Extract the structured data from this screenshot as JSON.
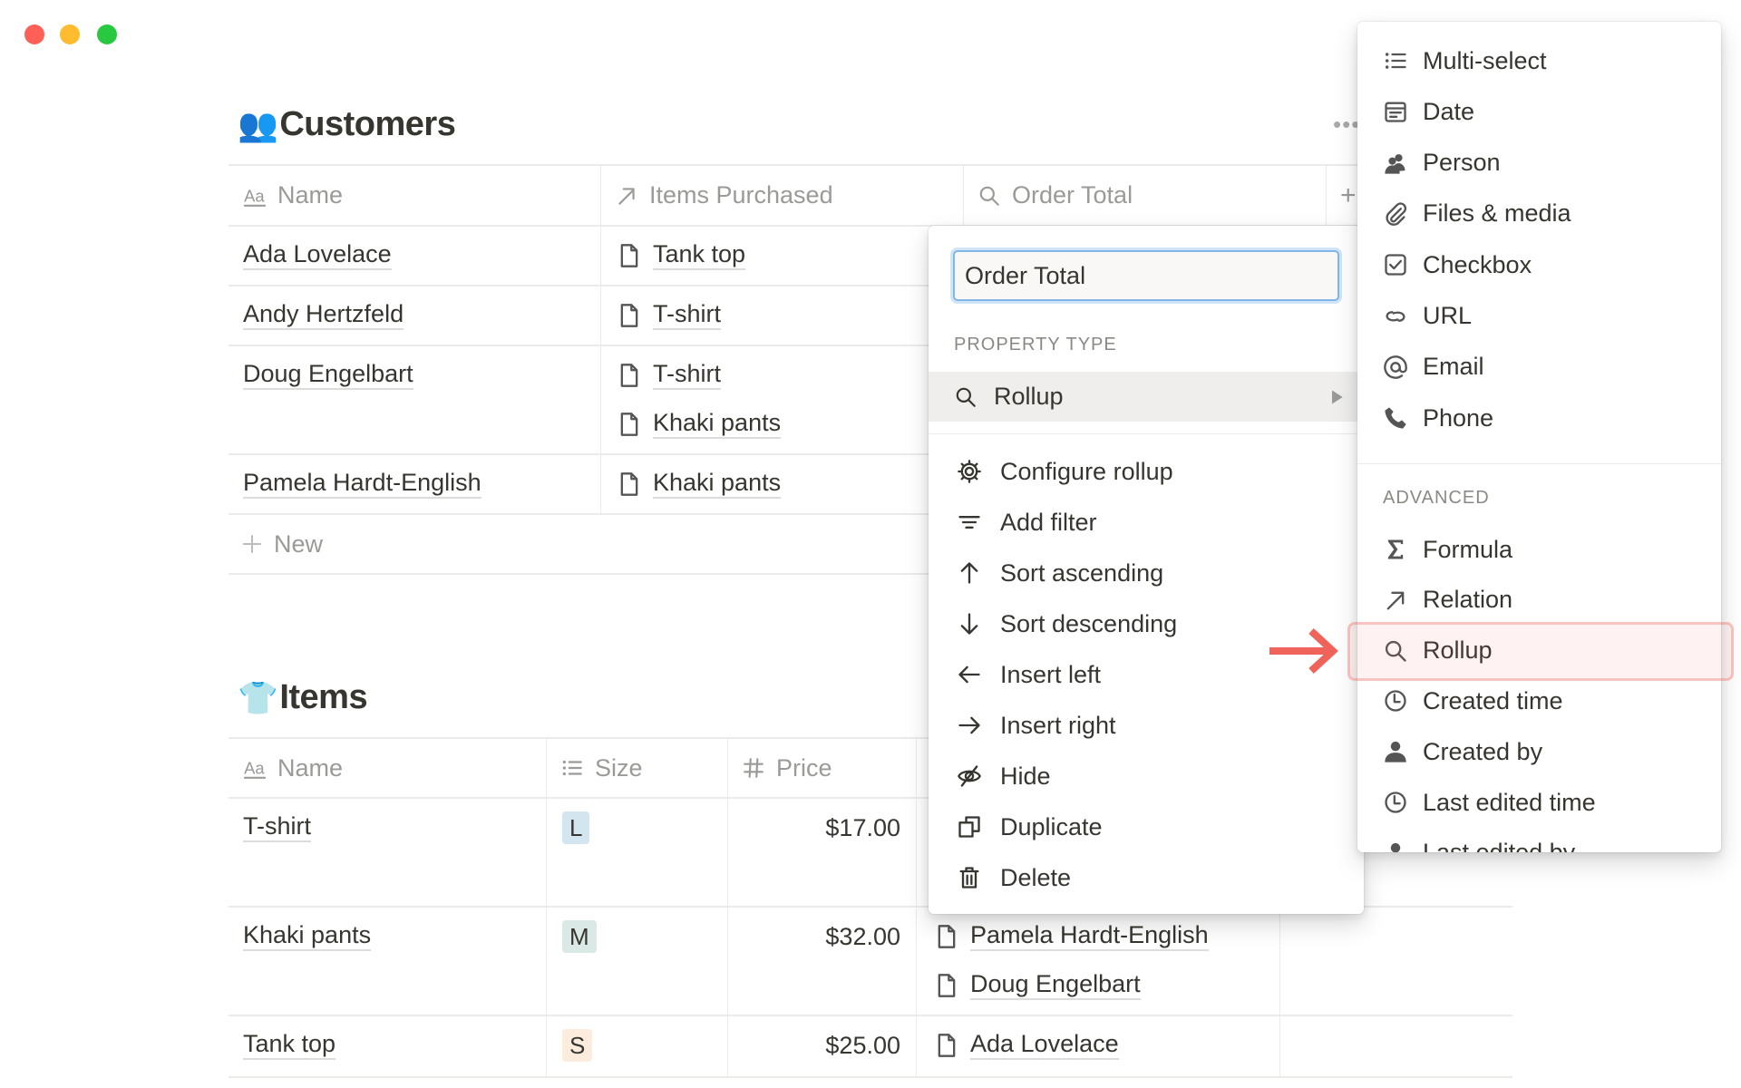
{
  "window": {
    "controls": [
      {
        "name": "close",
        "color": "#ff5f57"
      },
      {
        "name": "minimize",
        "color": "#febc2e"
      },
      {
        "name": "zoom",
        "color": "#28c840"
      }
    ]
  },
  "customers": {
    "emoji": "👥",
    "title": "Customers",
    "columns": [
      {
        "icon": "text-icon",
        "label": "Name"
      },
      {
        "icon": "arrow-up-right-icon",
        "label": "Items Purchased"
      },
      {
        "icon": "search-icon",
        "label": "Order Total"
      }
    ],
    "add_column": "+",
    "rows": [
      {
        "name": "Ada Lovelace",
        "items": [
          "Tank top"
        ]
      },
      {
        "name": "Andy Hertzfeld",
        "items": [
          "T-shirt"
        ]
      },
      {
        "name": "Doug Engelbart",
        "items": [
          "T-shirt",
          "Khaki pants"
        ]
      },
      {
        "name": "Pamela Hardt-English",
        "items": [
          "Khaki pants"
        ]
      }
    ],
    "new_label": "New"
  },
  "items": {
    "emoji": "👕",
    "title": "Items",
    "columns": [
      {
        "icon": "text-icon",
        "label": "Name"
      },
      {
        "icon": "list-icon",
        "label": "Size"
      },
      {
        "icon": "hash-icon",
        "label": "Price"
      }
    ],
    "rows": [
      {
        "name": "T-shirt",
        "size": "L",
        "size_color": "#d3e5ef",
        "price": "$17.00",
        "customers": []
      },
      {
        "name": "Khaki pants",
        "size": "M",
        "size_color": "#dbe9e6",
        "price": "$32.00",
        "customers": [
          "Pamela Hardt-English",
          "Doug Engelbart"
        ]
      },
      {
        "name": "Tank top",
        "size": "S",
        "size_color": "#fbecdd",
        "price": "$25.00",
        "customers": [
          "Ada Lovelace"
        ]
      }
    ]
  },
  "property_menu": {
    "name_input": "Order Total",
    "section_label": "PROPERTY TYPE",
    "type": {
      "icon": "search-icon",
      "label": "Rollup"
    },
    "actions": [
      {
        "icon": "gear-icon",
        "label": "Configure rollup"
      },
      {
        "icon": "filter-icon",
        "label": "Add filter"
      },
      {
        "icon": "arrow-up-icon",
        "label": "Sort ascending"
      },
      {
        "icon": "arrow-down-icon",
        "label": "Sort descending"
      },
      {
        "icon": "arrow-left-icon",
        "label": "Insert left"
      },
      {
        "icon": "arrow-right-icon",
        "label": "Insert right"
      },
      {
        "icon": "eye-off-icon",
        "label": "Hide"
      },
      {
        "icon": "duplicate-icon",
        "label": "Duplicate"
      },
      {
        "icon": "trash-icon",
        "label": "Delete"
      }
    ]
  },
  "type_menu": {
    "basic": [
      {
        "icon": "list-icon",
        "label": "Multi-select"
      },
      {
        "icon": "calendar-icon",
        "label": "Date"
      },
      {
        "icon": "people-icon",
        "label": "Person"
      },
      {
        "icon": "paperclip-icon",
        "label": "Files & media"
      },
      {
        "icon": "checkbox-icon",
        "label": "Checkbox"
      },
      {
        "icon": "link-icon",
        "label": "URL"
      },
      {
        "icon": "at-icon",
        "label": "Email"
      },
      {
        "icon": "phone-icon",
        "label": "Phone"
      }
    ],
    "advanced_label": "ADVANCED",
    "advanced": [
      {
        "icon": "sigma-icon",
        "label": "Formula"
      },
      {
        "icon": "arrow-up-right-icon",
        "label": "Relation"
      },
      {
        "icon": "search-icon",
        "label": "Rollup",
        "highlighted": true
      },
      {
        "icon": "clock-icon",
        "label": "Created time"
      },
      {
        "icon": "person-icon",
        "label": "Created by"
      },
      {
        "icon": "clock-icon",
        "label": "Last edited time"
      },
      {
        "icon": "person-icon",
        "label": "Last edited by"
      }
    ],
    "highlight_color": "#f0635a"
  }
}
